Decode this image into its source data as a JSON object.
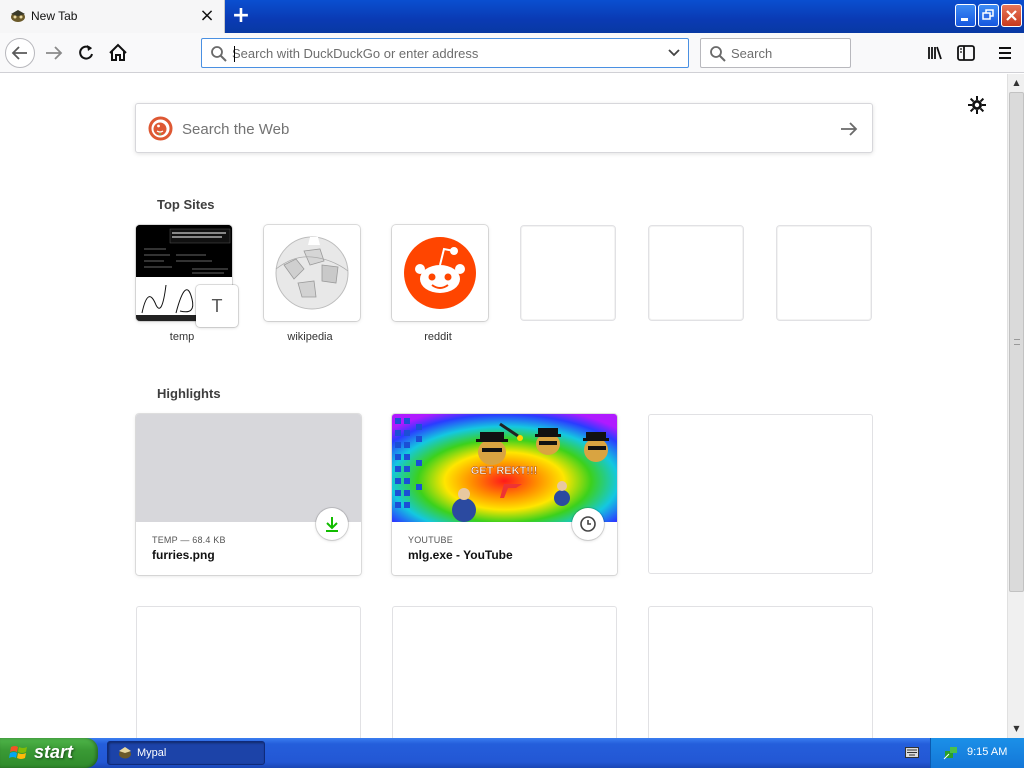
{
  "tab": {
    "title": "New Tab",
    "close": "×"
  },
  "newtab": "+",
  "urlbar": {
    "placeholder": "Search with DuckDuckGo or enter address"
  },
  "searchbar": {
    "placeholder": "Search"
  },
  "websearch": {
    "placeholder": "Search the Web"
  },
  "topsites": {
    "title": "Top Sites",
    "tiles": [
      {
        "label": "temp",
        "letter": "T"
      },
      {
        "label": "wikipedia"
      },
      {
        "label": "reddit"
      }
    ]
  },
  "highlights": {
    "title": "Highlights",
    "cards": [
      {
        "meta": "TEMP — 68.4 KB",
        "title": "furries.png",
        "icon": "download-icon"
      },
      {
        "meta": "YOUTUBE",
        "title": "mlg.exe - YouTube",
        "icon": "clock-icon",
        "thumb_text": "GET REKT!!!"
      }
    ]
  },
  "taskbar": {
    "start": "start",
    "app": "Mypal",
    "clock": "9:15 AM"
  },
  "colors": {
    "accent": "#0a84ff",
    "download": "#12bc00",
    "reddit": "#ff4500",
    "xp_blue": "#245edb",
    "xp_green": "#3a9a35"
  }
}
